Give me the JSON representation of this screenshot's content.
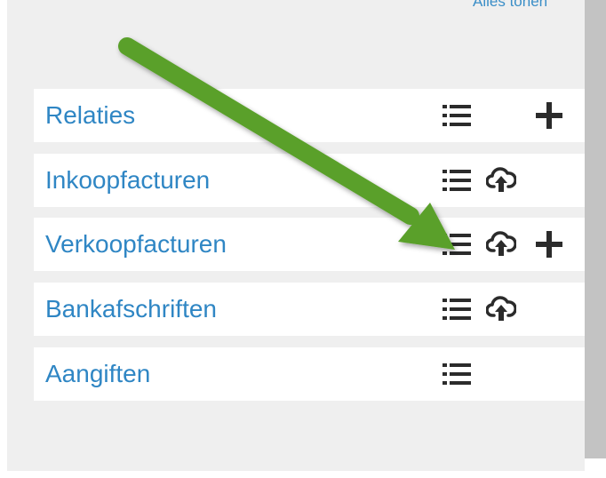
{
  "header": {
    "link_label": "Alles tonen"
  },
  "rows": [
    {
      "label": "Relaties",
      "icons": [
        "list-icon",
        "add-icon"
      ]
    },
    {
      "label": "Inkoopfacturen",
      "icons": [
        "list-icon",
        "cloud-upload-icon"
      ]
    },
    {
      "label": "Verkoopfacturen",
      "icons": [
        "list-icon",
        "cloud-upload-icon",
        "add-icon"
      ]
    },
    {
      "label": "Bankafschriften",
      "icons": [
        "list-icon",
        "cloud-upload-icon"
      ]
    },
    {
      "label": "Aangiften",
      "icons": [
        "list-icon"
      ]
    }
  ],
  "colors": {
    "link": "#2f86c4",
    "panel_bg": "#efefef",
    "row_bg": "#ffffff",
    "icon": "#2b2b2b",
    "arrow": "#5aa02c"
  }
}
